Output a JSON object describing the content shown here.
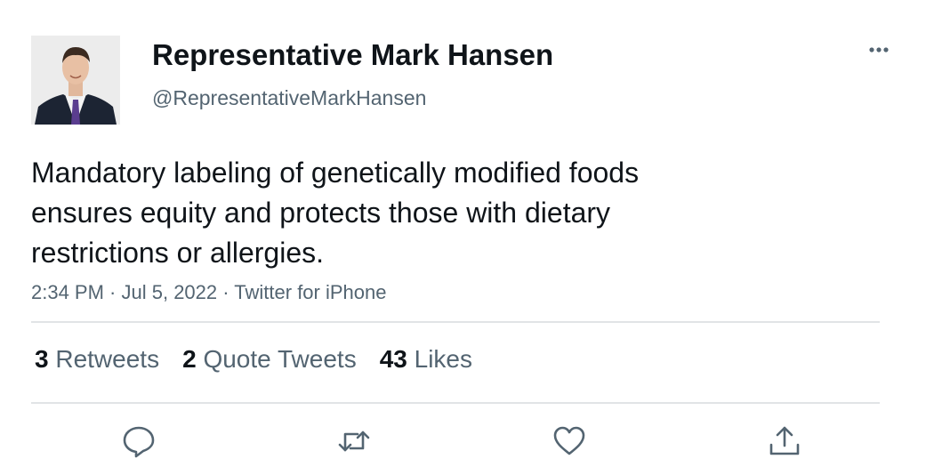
{
  "user": {
    "display_name": "Representative Mark Hansen",
    "handle": "@RepresentativeMarkHansen"
  },
  "tweet": {
    "text": "Mandatory labeling of genetically modified foods ensures equity and protects those with dietary restrictions or allergies.",
    "time": "2:34 PM",
    "date": "Jul 5, 2022",
    "source": "Twitter for iPhone",
    "separator": " · "
  },
  "stats": {
    "retweets_count": "3",
    "retweets_label": "Retweets",
    "quotes_count": "2",
    "quotes_label": "Quote Tweets",
    "likes_count": "43",
    "likes_label": "Likes"
  },
  "actions": {
    "reply_icon": "reply-icon",
    "retweet_icon": "retweet-icon",
    "like_icon": "heart-icon",
    "share_icon": "share-icon",
    "more_icon": "more-icon"
  },
  "colors": {
    "primary_text": "#0f1419",
    "secondary_text": "#536471",
    "divider": "#e1e4e6",
    "icon": "#536471"
  }
}
